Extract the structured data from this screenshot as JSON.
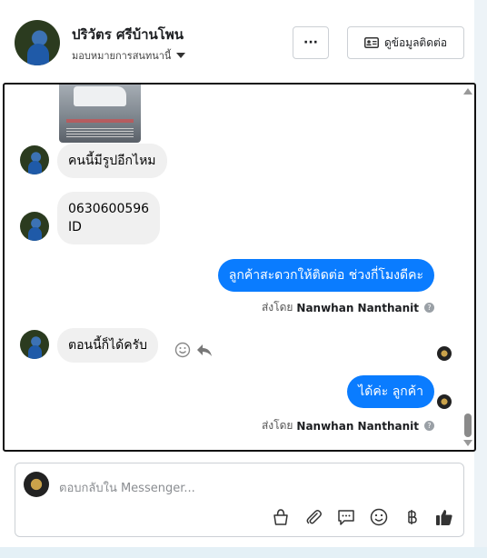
{
  "header": {
    "name": "ปริวัตร ศรีบ้านโพน",
    "assign_label": "มอบหมายการสนทนานี้",
    "more_label": "···",
    "contact_label": "ดูข้อมูลติดต่อ"
  },
  "messages": {
    "m1": "คนนี้มีรูปอีกไหม",
    "m2_line1": "0630600596",
    "m2_line2": "ID",
    "m3": "ลูกค้าสะดวกให้ติดต่อ ช่วงกี่โมงดีคะ",
    "m4": "ตอนนี้ก็ได้ครับ",
    "m5": "ได้ค่ะ  ลูกค้า"
  },
  "sent_by": {
    "prefix": "ส่งโดย",
    "agent": "Nanwhan Nanthanit",
    "help": "?"
  },
  "composer": {
    "placeholder": "ตอบกลับใน Messenger..."
  },
  "icons": [
    "more-icon",
    "contact-card-icon",
    "emoji-icon",
    "reply-icon",
    "gift-icon",
    "attach-icon",
    "chat-bubble-icon",
    "baht-icon",
    "like-icon"
  ]
}
